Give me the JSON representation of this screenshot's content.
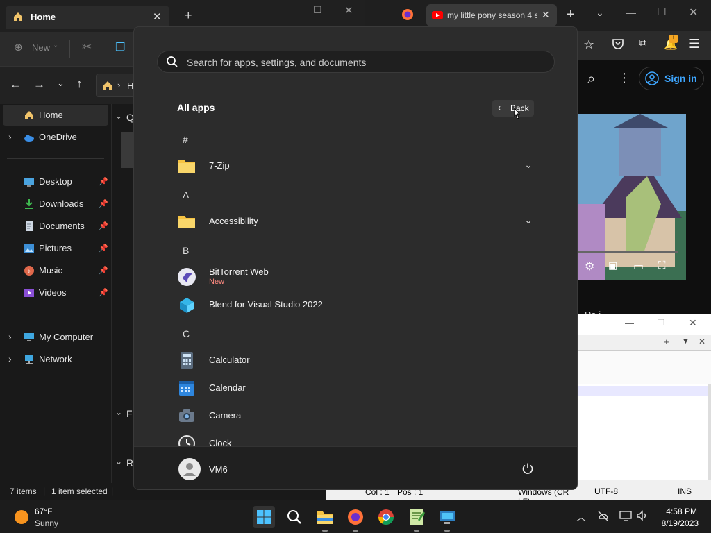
{
  "explorer": {
    "tab_title": "Home",
    "new_label": "New",
    "address_crumb": "H",
    "section_quick": "Q",
    "section_favorites": "Fa",
    "section_recent": "R",
    "nav": [
      {
        "label": "Home",
        "icon": "home-icon"
      },
      {
        "label": "OneDrive",
        "icon": "cloud-icon"
      },
      {
        "label": "Desktop",
        "icon": "desktop-icon"
      },
      {
        "label": "Downloads",
        "icon": "download-icon"
      },
      {
        "label": "Documents",
        "icon": "document-icon"
      },
      {
        "label": "Pictures",
        "icon": "pictures-icon"
      },
      {
        "label": "Music",
        "icon": "music-icon"
      },
      {
        "label": "Videos",
        "icon": "videos-icon"
      },
      {
        "label": "My Computer",
        "icon": "computer-icon"
      },
      {
        "label": "Network",
        "icon": "network-icon"
      }
    ],
    "status_items": "7 items",
    "status_selected": "1 item selected"
  },
  "browser": {
    "tab_title": "my little pony season 4 e",
    "signin_label": "Sign in",
    "notification_badge": "!",
    "partial_text": "Ra i"
  },
  "editor": {
    "status_col": "Col : 1",
    "status_pos": "Pos : 1",
    "status_eol": "Windows (CR LF)",
    "status_encoding": "UTF-8",
    "status_mode": "INS"
  },
  "start": {
    "search_placeholder": "Search for apps, settings, and documents",
    "all_apps_label": "All apps",
    "back_label": "Back",
    "groups": [
      {
        "letter": "#",
        "apps": [
          {
            "name": "7-Zip",
            "icon": "folder-icon",
            "expandable": true
          }
        ]
      },
      {
        "letter": "A",
        "apps": [
          {
            "name": "Accessibility",
            "icon": "folder-icon",
            "expandable": true
          }
        ]
      },
      {
        "letter": "B",
        "apps": [
          {
            "name": "BitTorrent Web",
            "sub": "New",
            "icon": "bittorrent-icon"
          },
          {
            "name": "Blend for Visual Studio 2022",
            "icon": "blend-icon"
          }
        ]
      },
      {
        "letter": "C",
        "apps": [
          {
            "name": "Calculator",
            "icon": "calculator-icon"
          },
          {
            "name": "Calendar",
            "icon": "calendar-icon"
          },
          {
            "name": "Camera",
            "icon": "camera-icon"
          },
          {
            "name": "Clock",
            "icon": "clock-icon"
          }
        ]
      }
    ],
    "user_name": "VM6"
  },
  "taskbar": {
    "weather_temp": "67°F",
    "weather_desc": "Sunny",
    "time": "4:58 PM",
    "date": "8/19/2023"
  },
  "colors": {
    "accent": "#4cc2ff",
    "folder": "#f6c342",
    "new_badge": "#ff8a80"
  }
}
